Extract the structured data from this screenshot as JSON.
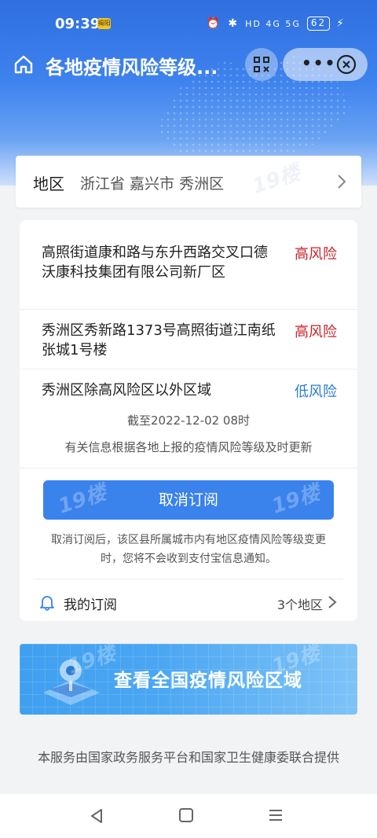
{
  "status_bar": {
    "time": "09:39",
    "badge": "揭阳",
    "network": "HD 4G 5G",
    "battery": "62"
  },
  "titlebar": {
    "title": "各地疫情风险等级...",
    "icons": [
      "home-icon",
      "qr-scan-icon",
      "more-icon",
      "close-icon"
    ]
  },
  "region": {
    "label": "地区",
    "value": "浙江省 嘉兴市 秀洲区"
  },
  "risk_areas": [
    {
      "address": "高照街道康和路与东升西路交叉口德沃康科技集团有限公司新厂区",
      "level": "高风险",
      "type": "high"
    },
    {
      "address": "秀洲区秀新路1373号高照街道江南纸张城1号楼",
      "level": "高风险",
      "type": "high"
    },
    {
      "address": "秀洲区除高风险区以外区域",
      "level": "低风险",
      "type": "low"
    }
  ],
  "as_of": "截至2022-12-02 08时",
  "update_note": "有关信息根据各地上报的疫情风险等级及时更新",
  "unsubscribe": {
    "button_label": "取消订阅",
    "note": "取消订阅后，该区县所属城市内有地区疫情风险等级变更时，您将不会收到支付宝信息通知。"
  },
  "subscription": {
    "label": "我的订阅",
    "count": "3个地区"
  },
  "banner": {
    "text": "查看全国疫情风险区域"
  },
  "footer": "本服务由国家政务服务平台和国家卫生健康委联合提供",
  "watermark": "19楼",
  "colors": {
    "primary": "#3a82ec",
    "high_risk": "#c8242b",
    "low_risk": "#2b7bd1"
  }
}
